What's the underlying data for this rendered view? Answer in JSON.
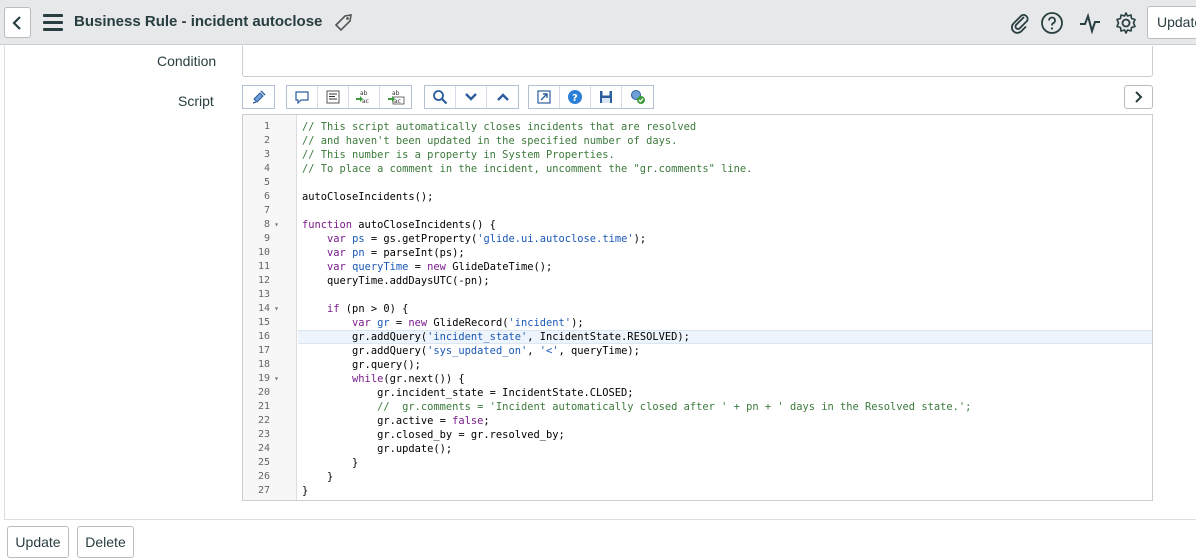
{
  "header": {
    "title": "Business Rule - incident autoclose",
    "update_label": "Update"
  },
  "form": {
    "condition_label": "Condition",
    "script_label": "Script"
  },
  "toolbar": {
    "icons": [
      "toggle-syntax-editor-icon",
      "comment-icon",
      "format-code-icon",
      "replace-icon",
      "replace-all-icon",
      "search-icon",
      "expand-icon",
      "collapse-icon",
      "fullscreen-icon",
      "help-icon",
      "save-icon",
      "script-debugger-icon"
    ]
  },
  "editor": {
    "lines": [
      {
        "n": "1",
        "fold": "",
        "segs": [
          {
            "t": "// This script automatically closes incidents that are resolved",
            "c": "t-comment"
          }
        ]
      },
      {
        "n": "2",
        "fold": "",
        "segs": [
          {
            "t": "// and haven't been updated in the specified number of days.",
            "c": "t-comment"
          }
        ]
      },
      {
        "n": "3",
        "fold": "",
        "segs": [
          {
            "t": "// This number is a property in System Properties.",
            "c": "t-comment"
          }
        ]
      },
      {
        "n": "4",
        "fold": "",
        "segs": [
          {
            "t": "// To place a comment in the incident, uncomment the \"gr.comments\" line.",
            "c": "t-comment"
          }
        ]
      },
      {
        "n": "5",
        "fold": "",
        "segs": []
      },
      {
        "n": "6",
        "fold": "",
        "segs": [
          {
            "t": "autoCloseIncidents();",
            "c": "t-plain"
          }
        ]
      },
      {
        "n": "7",
        "fold": "",
        "segs": []
      },
      {
        "n": "8",
        "fold": "▾",
        "segs": [
          {
            "t": "function",
            "c": "t-kw"
          },
          {
            "t": " autoCloseIncidents() {",
            "c": "t-plain"
          }
        ]
      },
      {
        "n": "9",
        "fold": "",
        "segs": [
          {
            "t": "    ",
            "c": "t-plain"
          },
          {
            "t": "var",
            "c": "t-kw"
          },
          {
            "t": " ",
            "c": "t-plain"
          },
          {
            "t": "ps",
            "c": "t-var"
          },
          {
            "t": " = gs.getProperty(",
            "c": "t-plain"
          },
          {
            "t": "'glide.ui.autoclose.time'",
            "c": "t-str"
          },
          {
            "t": ");",
            "c": "t-plain"
          }
        ]
      },
      {
        "n": "10",
        "fold": "",
        "segs": [
          {
            "t": "    ",
            "c": "t-plain"
          },
          {
            "t": "var",
            "c": "t-kw"
          },
          {
            "t": " ",
            "c": "t-plain"
          },
          {
            "t": "pn",
            "c": "t-var"
          },
          {
            "t": " = parseInt(ps);",
            "c": "t-plain"
          }
        ]
      },
      {
        "n": "11",
        "fold": "",
        "segs": [
          {
            "t": "    ",
            "c": "t-plain"
          },
          {
            "t": "var",
            "c": "t-kw"
          },
          {
            "t": " ",
            "c": "t-plain"
          },
          {
            "t": "queryTime",
            "c": "t-var"
          },
          {
            "t": " = ",
            "c": "t-plain"
          },
          {
            "t": "new",
            "c": "t-kw"
          },
          {
            "t": " GlideDateTime();",
            "c": "t-plain"
          }
        ]
      },
      {
        "n": "12",
        "fold": "",
        "segs": [
          {
            "t": "    queryTime.addDaysUTC(-pn);",
            "c": "t-plain"
          }
        ]
      },
      {
        "n": "13",
        "fold": "",
        "segs": []
      },
      {
        "n": "14",
        "fold": "▾",
        "segs": [
          {
            "t": "    ",
            "c": "t-plain"
          },
          {
            "t": "if",
            "c": "t-kw"
          },
          {
            "t": " (pn > 0) {",
            "c": "t-plain"
          }
        ]
      },
      {
        "n": "15",
        "fold": "",
        "segs": [
          {
            "t": "        ",
            "c": "t-plain"
          },
          {
            "t": "var",
            "c": "t-kw"
          },
          {
            "t": " ",
            "c": "t-plain"
          },
          {
            "t": "gr",
            "c": "t-var"
          },
          {
            "t": " = ",
            "c": "t-plain"
          },
          {
            "t": "new",
            "c": "t-kw"
          },
          {
            "t": " GlideRecord(",
            "c": "t-plain"
          },
          {
            "t": "'incident'",
            "c": "t-str"
          },
          {
            "t": ");",
            "c": "t-plain"
          }
        ]
      },
      {
        "n": "16",
        "fold": "",
        "active": true,
        "segs": [
          {
            "t": "        gr.addQuery(",
            "c": "t-plain"
          },
          {
            "t": "'incident_state'",
            "c": "t-str"
          },
          {
            "t": ", IncidentState.RESOLVED);",
            "c": "t-plain"
          }
        ]
      },
      {
        "n": "17",
        "fold": "",
        "segs": [
          {
            "t": "        gr.addQuery(",
            "c": "t-plain"
          },
          {
            "t": "'sys_updated_on'",
            "c": "t-str"
          },
          {
            "t": ", ",
            "c": "t-plain"
          },
          {
            "t": "'<'",
            "c": "t-str"
          },
          {
            "t": ", queryTime);",
            "c": "t-plain"
          }
        ]
      },
      {
        "n": "18",
        "fold": "",
        "segs": [
          {
            "t": "        gr.query();",
            "c": "t-plain"
          }
        ]
      },
      {
        "n": "19",
        "fold": "▾",
        "segs": [
          {
            "t": "        ",
            "c": "t-plain"
          },
          {
            "t": "while",
            "c": "t-kw"
          },
          {
            "t": "(gr.next()) {",
            "c": "t-plain"
          }
        ]
      },
      {
        "n": "20",
        "fold": "",
        "segs": [
          {
            "t": "            gr.incident_state = IncidentState.CLOSED;",
            "c": "t-plain"
          }
        ]
      },
      {
        "n": "21",
        "fold": "",
        "segs": [
          {
            "t": "            //  gr.comments = 'Incident automatically closed after ' + pn + ' days in the Resolved state.';",
            "c": "t-comment"
          }
        ]
      },
      {
        "n": "22",
        "fold": "",
        "segs": [
          {
            "t": "            gr.active = ",
            "c": "t-plain"
          },
          {
            "t": "false",
            "c": "t-kw"
          },
          {
            "t": ";",
            "c": "t-plain"
          }
        ]
      },
      {
        "n": "23",
        "fold": "",
        "segs": [
          {
            "t": "            gr.closed_by = gr.resolved_by;",
            "c": "t-plain"
          }
        ]
      },
      {
        "n": "24",
        "fold": "",
        "segs": [
          {
            "t": "            gr.update();",
            "c": "t-plain"
          }
        ]
      },
      {
        "n": "25",
        "fold": "",
        "segs": [
          {
            "t": "        }",
            "c": "t-plain"
          }
        ]
      },
      {
        "n": "26",
        "fold": "",
        "segs": [
          {
            "t": "    }",
            "c": "t-plain"
          }
        ]
      },
      {
        "n": "27",
        "fold": "",
        "segs": [
          {
            "t": "}",
            "c": "t-plain"
          }
        ]
      }
    ]
  },
  "footer": {
    "update_label": "Update",
    "delete_label": "Delete"
  }
}
